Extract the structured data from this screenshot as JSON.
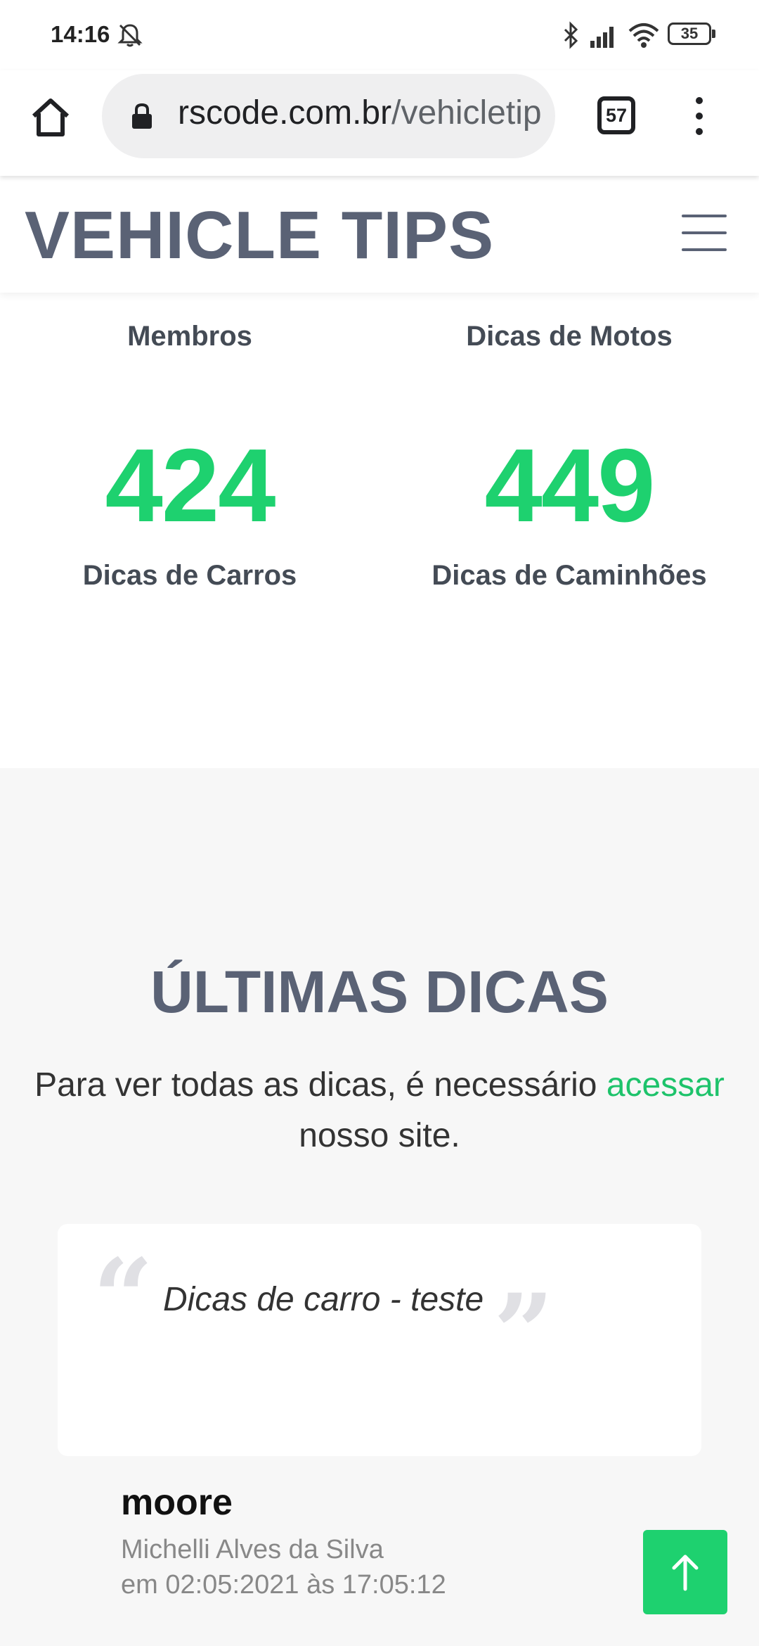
{
  "status_bar": {
    "time": "14:16",
    "battery": "35"
  },
  "browser": {
    "url_domain": "rscode.com.br",
    "url_path": "/vehicletip",
    "tab_count": "57"
  },
  "site": {
    "logo": "VEHICLE TIPS"
  },
  "stats": [
    {
      "label": "Membros"
    },
    {
      "label": "Dicas de Motos"
    },
    {
      "number": "424",
      "label": "Dicas de Carros"
    },
    {
      "number": "449",
      "label": "Dicas de Caminhões"
    }
  ],
  "tips": {
    "title": "ÚLTIMAS DICAS",
    "text_before": "Para ver todas as dicas, é necessário ",
    "link": "acessar",
    "text_after": " nosso site.",
    "card": {
      "text": "Dicas de carro - teste",
      "open_quote": "“",
      "close_quote": "”"
    },
    "author": {
      "user": "moore",
      "name": "Michelli Alves da Silva",
      "date": "em 02:05:2021 às 17:05:12"
    }
  },
  "colors": {
    "accent": "#1ed16f",
    "heading": "#5a6275"
  }
}
